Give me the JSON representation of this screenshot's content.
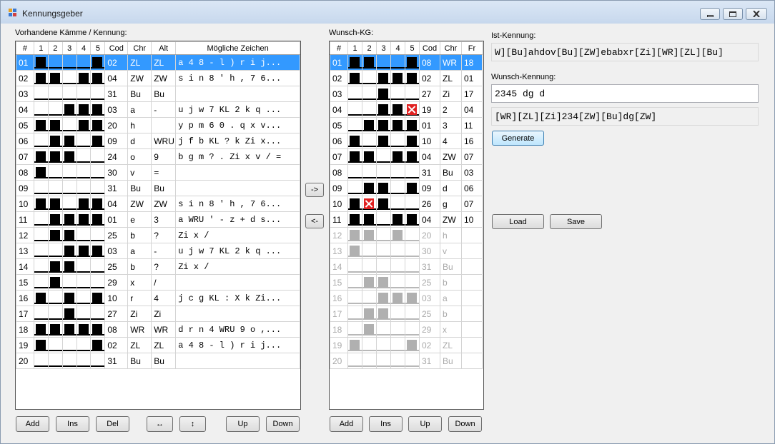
{
  "window": {
    "title": "Kennungsgeber"
  },
  "labels": {
    "left_grid": "Vorhandene Kämme / Kennung:",
    "right_grid": "Wunsch-KG:",
    "ist": "Ist-Kennung:",
    "wunsch": "Wunsch-Kennung:"
  },
  "fields": {
    "ist_value": "W][Bu]ahdov[Bu][ZW]ebabxr[Zi][WR][ZL][Bu]",
    "wunsch_value": "2345 dg d",
    "result_value": "[WR][ZL][Zi]234[ZW][Bu]dg[ZW]"
  },
  "buttons": {
    "generate": "Generate",
    "load": "Load",
    "save": "Save",
    "move_right": "->",
    "move_left": "<-",
    "left_add": "Add",
    "left_ins": "Ins",
    "left_del": "Del",
    "left_swap_h": "↔",
    "left_swap_v": "↕",
    "left_up": "Up",
    "left_down": "Down",
    "right_add": "Add",
    "right_ins": "Ins",
    "right_up": "Up",
    "right_down": "Down"
  },
  "left_grid": {
    "columns": [
      "#",
      "1",
      "2",
      "3",
      "4",
      "5",
      "Cod",
      "Chr",
      "Alt",
      "Mögliche Zeichen"
    ],
    "selected_row": 0,
    "rows": [
      {
        "n": "01",
        "bits": [
          1,
          0,
          0,
          0,
          1
        ],
        "cod": "02",
        "chr": "ZL",
        "alt": "ZL",
        "chars": "a 4 8 - l ) r i j..."
      },
      {
        "n": "02",
        "bits": [
          1,
          1,
          0,
          1,
          1
        ],
        "cod": "04",
        "chr": "ZW",
        "alt": "ZW",
        "chars": "s i n 8 ' h , 7 6..."
      },
      {
        "n": "03",
        "bits": [
          0,
          0,
          0,
          0,
          0
        ],
        "cod": "31",
        "chr": "Bu",
        "alt": "Bu",
        "chars": ""
      },
      {
        "n": "04",
        "bits": [
          0,
          0,
          1,
          1,
          1
        ],
        "cod": "03",
        "chr": "a",
        "alt": "-",
        "chars": "u j w 7 KL 2 k q ..."
      },
      {
        "n": "05",
        "bits": [
          1,
          1,
          0,
          1,
          1
        ],
        "cod": "20",
        "chr": "h",
        "alt": "",
        "chars": "y p m 6 0 . q x v..."
      },
      {
        "n": "06",
        "bits": [
          0,
          1,
          1,
          0,
          1
        ],
        "cod": "09",
        "chr": "d",
        "alt": "WRU",
        "chars": "j f b KL ? k Zi x..."
      },
      {
        "n": "07",
        "bits": [
          1,
          1,
          1,
          0,
          0
        ],
        "cod": "24",
        "chr": "o",
        "alt": "9",
        "chars": "b g m ? . Zi x v / ="
      },
      {
        "n": "08",
        "bits": [
          1,
          0,
          0,
          0,
          0
        ],
        "cod": "30",
        "chr": "v",
        "alt": "=",
        "chars": ""
      },
      {
        "n": "09",
        "bits": [
          0,
          0,
          0,
          0,
          0
        ],
        "cod": "31",
        "chr": "Bu",
        "alt": "Bu",
        "chars": ""
      },
      {
        "n": "10",
        "bits": [
          1,
          1,
          0,
          1,
          1
        ],
        "cod": "04",
        "chr": "ZW",
        "alt": "ZW",
        "chars": "s i n 8 ' h , 7 6..."
      },
      {
        "n": "11",
        "bits": [
          0,
          1,
          1,
          1,
          1
        ],
        "cod": "01",
        "chr": "e",
        "alt": "3",
        "chars": "a WRU ' - z + d s..."
      },
      {
        "n": "12",
        "bits": [
          0,
          1,
          1,
          0,
          0
        ],
        "cod": "25",
        "chr": "b",
        "alt": "?",
        "chars": "Zi x /"
      },
      {
        "n": "13",
        "bits": [
          0,
          0,
          1,
          1,
          1
        ],
        "cod": "03",
        "chr": "a",
        "alt": "-",
        "chars": "u j w 7 KL 2 k q ..."
      },
      {
        "n": "14",
        "bits": [
          0,
          1,
          1,
          0,
          0
        ],
        "cod": "25",
        "chr": "b",
        "alt": "?",
        "chars": "Zi x /"
      },
      {
        "n": "15",
        "bits": [
          0,
          1,
          0,
          0,
          0
        ],
        "cod": "29",
        "chr": "x",
        "alt": "/",
        "chars": ""
      },
      {
        "n": "16",
        "bits": [
          1,
          0,
          1,
          0,
          1
        ],
        "cod": "10",
        "chr": "r",
        "alt": "4",
        "chars": "j c g KL : X k Zi..."
      },
      {
        "n": "17",
        "bits": [
          0,
          0,
          1,
          0,
          0
        ],
        "cod": "27",
        "chr": "Zi",
        "alt": "Zi",
        "chars": ""
      },
      {
        "n": "18",
        "bits": [
          1,
          1,
          1,
          1,
          1
        ],
        "cod": "08",
        "chr": "WR",
        "alt": "WR",
        "chars": "d r n 4 WRU 9 o ,..."
      },
      {
        "n": "19",
        "bits": [
          1,
          0,
          0,
          0,
          1
        ],
        "cod": "02",
        "chr": "ZL",
        "alt": "ZL",
        "chars": "a 4 8 - l ) r i j..."
      },
      {
        "n": "20",
        "bits": [
          0,
          0,
          0,
          0,
          0
        ],
        "cod": "31",
        "chr": "Bu",
        "alt": "Bu",
        "chars": ""
      }
    ]
  },
  "right_grid": {
    "columns": [
      "#",
      "1",
      "2",
      "3",
      "4",
      "5",
      "Cod",
      "Chr",
      "Fr"
    ],
    "selected_row": 0,
    "active_rows": 11,
    "rows": [
      {
        "n": "01",
        "bits": [
          1,
          1,
          0,
          0,
          1
        ],
        "cod": "08",
        "chr": "WR",
        "fr": "18"
      },
      {
        "n": "02",
        "bits": [
          1,
          0,
          1,
          1,
          1
        ],
        "cod": "02",
        "chr": "ZL",
        "fr": "01"
      },
      {
        "n": "03",
        "bits": [
          0,
          0,
          1,
          0,
          0
        ],
        "cod": "27",
        "chr": "Zi",
        "fr": "17"
      },
      {
        "n": "04",
        "bits": [
          0,
          0,
          1,
          1,
          2
        ],
        "cod": "19",
        "chr": "2",
        "fr": "04"
      },
      {
        "n": "05",
        "bits": [
          0,
          1,
          1,
          1,
          1
        ],
        "cod": "01",
        "chr": "3",
        "fr": "11"
      },
      {
        "n": "06",
        "bits": [
          1,
          0,
          1,
          0,
          1
        ],
        "cod": "10",
        "chr": "4",
        "fr": "16"
      },
      {
        "n": "07",
        "bits": [
          1,
          1,
          0,
          1,
          1
        ],
        "cod": "04",
        "chr": "ZW",
        "fr": "07"
      },
      {
        "n": "08",
        "bits": [
          0,
          0,
          0,
          0,
          0
        ],
        "cod": "31",
        "chr": "Bu",
        "fr": "03"
      },
      {
        "n": "09",
        "bits": [
          0,
          1,
          1,
          0,
          1
        ],
        "cod": "09",
        "chr": "d",
        "fr": "06"
      },
      {
        "n": "10",
        "bits": [
          1,
          2,
          1,
          0,
          0
        ],
        "cod": "26",
        "chr": "g",
        "fr": "07"
      },
      {
        "n": "11",
        "bits": [
          1,
          1,
          0,
          1,
          1
        ],
        "cod": "04",
        "chr": "ZW",
        "fr": "10"
      },
      {
        "n": "12",
        "bits": [
          1,
          1,
          0,
          1,
          0
        ],
        "cod": "20",
        "chr": "h",
        "fr": ""
      },
      {
        "n": "13",
        "bits": [
          1,
          0,
          0,
          0,
          0
        ],
        "cod": "30",
        "chr": "v",
        "fr": ""
      },
      {
        "n": "14",
        "bits": [
          0,
          0,
          0,
          0,
          0
        ],
        "cod": "31",
        "chr": "Bu",
        "fr": ""
      },
      {
        "n": "15",
        "bits": [
          0,
          1,
          1,
          0,
          0
        ],
        "cod": "25",
        "chr": "b",
        "fr": ""
      },
      {
        "n": "16",
        "bits": [
          0,
          0,
          1,
          1,
          1
        ],
        "cod": "03",
        "chr": "a",
        "fr": ""
      },
      {
        "n": "17",
        "bits": [
          0,
          1,
          1,
          0,
          0
        ],
        "cod": "25",
        "chr": "b",
        "fr": ""
      },
      {
        "n": "18",
        "bits": [
          0,
          1,
          0,
          0,
          0
        ],
        "cod": "29",
        "chr": "x",
        "fr": ""
      },
      {
        "n": "19",
        "bits": [
          1,
          0,
          0,
          0,
          1
        ],
        "cod": "02",
        "chr": "ZL",
        "fr": ""
      },
      {
        "n": "20",
        "bits": [
          0,
          0,
          0,
          0,
          0
        ],
        "cod": "31",
        "chr": "Bu",
        "fr": ""
      }
    ]
  }
}
